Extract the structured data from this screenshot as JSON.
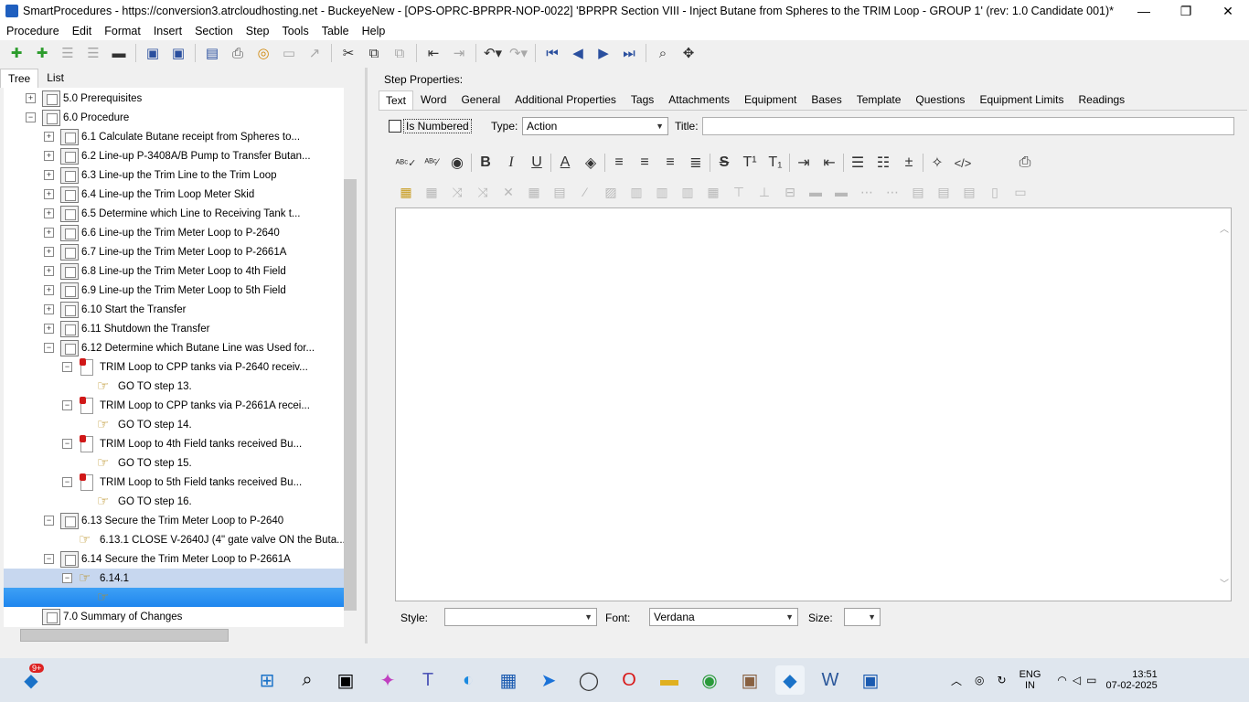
{
  "window": {
    "title": "SmartProcedures - https://conversion3.atrcloudhosting.net - BuckeyeNew - [OPS-OPRC-BPRPR-NOP-0022] 'BPRPR Section VIII - Inject Butane from Spheres to the TRIM Loop - GROUP 1' (rev: 1.0 Candidate 001)*",
    "minimize": "—",
    "maximize": "❐",
    "close": "✕"
  },
  "menu": [
    "Procedure",
    "Edit",
    "Format",
    "Insert",
    "Section",
    "Step",
    "Tools",
    "Table",
    "Help"
  ],
  "left_tabs": [
    "Tree",
    "List"
  ],
  "tree": [
    {
      "label": "5.0 Prerequisites",
      "exp": "+"
    },
    {
      "label": "6.0 Procedure",
      "exp": "−"
    },
    {
      "label": "6.1 Calculate Butane receipt from Spheres to...",
      "exp": "+"
    },
    {
      "label": "6.2 Line-up P-3408A/B Pump to Transfer Butan...",
      "exp": "+"
    },
    {
      "label": "6.3 Line-up the Trim Line to the Trim Loop",
      "exp": "+"
    },
    {
      "label": "6.4 Line-up the Trim Loop Meter Skid",
      "exp": "+"
    },
    {
      "label": "6.5 Determine which Line to Receiving Tank t...",
      "exp": "+"
    },
    {
      "label": "6.6 Line-up the Trim Meter Loop to P-2640",
      "exp": "+"
    },
    {
      "label": "6.7 Line-up the Trim Meter Loop to P-2661A",
      "exp": "+"
    },
    {
      "label": "6.8 Line-up the Trim Meter Loop to 4th Field",
      "exp": "+"
    },
    {
      "label": "6.9 Line-up the Trim Meter Loop to 5th Field",
      "exp": "+"
    },
    {
      "label": "6.10 Start the Transfer",
      "exp": "+"
    },
    {
      "label": "6.11 Shutdown the Transfer",
      "exp": "+"
    },
    {
      "label": "6.12 Determine which Butane Line was Used for...",
      "exp": "−"
    },
    {
      "label": "TRIM Loop to CPP tanks via P-2640 receiv...",
      "exp": "−"
    },
    {
      "label": "GO TO step 13.",
      "exp": ""
    },
    {
      "label": "TRIM Loop to CPP tanks via P-2661A recei...",
      "exp": "−"
    },
    {
      "label": "GO TO step 14.",
      "exp": ""
    },
    {
      "label": "TRIM Loop to 4th Field tanks received Bu...",
      "exp": "−"
    },
    {
      "label": "GO TO step 15.",
      "exp": ""
    },
    {
      "label": "TRIM Loop to 5th Field tanks received Bu...",
      "exp": "−"
    },
    {
      "label": "GO TO step 16.",
      "exp": ""
    },
    {
      "label": "6.13 Secure the Trim Meter Loop to P-2640",
      "exp": "−"
    },
    {
      "label": "6.13.1 CLOSE V-2640J (4\" gate valve ON the Buta...",
      "exp": ""
    },
    {
      "label": "6.14 Secure the Trim Meter Loop to P-2661A",
      "exp": "−"
    },
    {
      "label": "6.14.1",
      "exp": "−"
    },
    {
      "label": "",
      "exp": ""
    },
    {
      "label": "7.0 Summary of Changes",
      "exp": ""
    }
  ],
  "props": {
    "header": "Step Properties:",
    "tabs": [
      "Text",
      "Word",
      "General",
      "Additional Properties",
      "Tags",
      "Attachments",
      "Equipment",
      "Bases",
      "Template",
      "Questions",
      "Equipment Limits",
      "Readings"
    ],
    "is_numbered": "Is Numbered",
    "type_label": "Type:",
    "type_value": "Action",
    "title_label": "Title:",
    "style_label": "Style:",
    "style_value": "",
    "font_label": "Font:",
    "font_value": "Verdana",
    "size_label": "Size:",
    "size_value": ""
  },
  "taskbar": {
    "badge": "9+",
    "lang1": "ENG",
    "lang2": "IN",
    "time": "13:51",
    "date": "07-02-2025"
  }
}
